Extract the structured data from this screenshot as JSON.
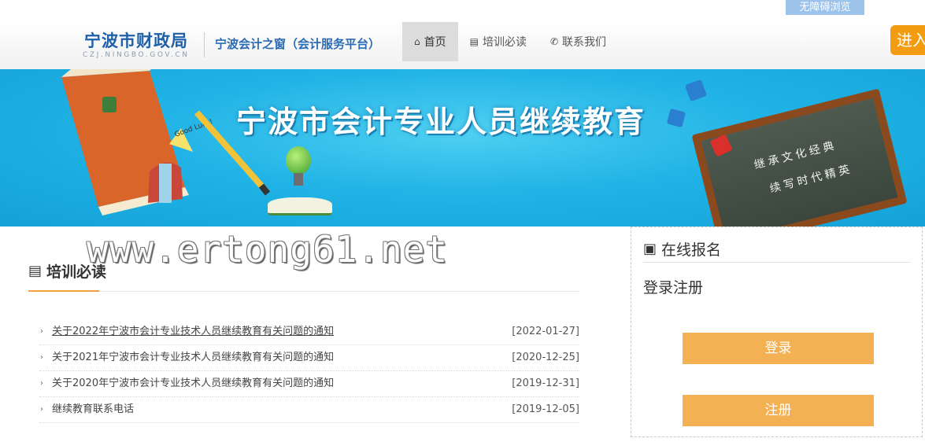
{
  "accessibility_label": "无障碍浏览",
  "header": {
    "logo_cn": "宁波市财政局",
    "logo_en": "CZJ.NINGBO.GOV.CN",
    "subtitle": "宁波会计之窗（会计服务平台）",
    "nav": [
      {
        "label": "首页",
        "icon": "home-icon",
        "active": true
      },
      {
        "label": "培训必读",
        "icon": "newspaper-icon",
        "active": false
      },
      {
        "label": "联系我们",
        "icon": "phone-icon",
        "active": false
      }
    ],
    "enter_label": "进入"
  },
  "banner": {
    "title": "宁波市会计专业人员继续教育",
    "book_sticker": "Good Luck!",
    "board_line1": "继承文化经典",
    "board_line2": "续写时代精英"
  },
  "watermark": "www.ertong61.net",
  "news": {
    "heading": "培训必读",
    "items": [
      {
        "title": "关于2022年宁波市会计专业技术人员继续教育有关问题的通知",
        "date": "[2022-01-27]"
      },
      {
        "title": "关于2021年宁波市会计专业技术人员继续教育有关问题的通知",
        "date": "[2020-12-25]"
      },
      {
        "title": "关于2020年宁波市会计专业技术人员继续教育有关问题的通知",
        "date": "[2019-12-31]"
      },
      {
        "title": "继续教育联系电话",
        "date": "[2019-12-05]"
      }
    ]
  },
  "panel": {
    "heading": "在线报名",
    "subheading": "登录注册",
    "login_label": "登录",
    "register_label": "注册"
  },
  "colors": {
    "brand_blue": "#1f5fa8",
    "accent_orange": "#f3b153",
    "banner_blue": "#22b4e6"
  }
}
